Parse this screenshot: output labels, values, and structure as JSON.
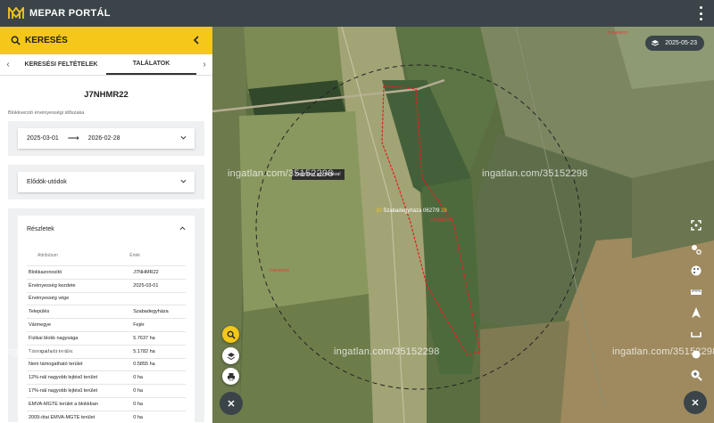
{
  "app": {
    "title": "MEPAR PORTÁL"
  },
  "panel": {
    "title": "KERESÉS",
    "tabs": [
      "KERESÉSI FELTÉTELEK",
      "TALÁLATOK"
    ],
    "block_id": "J7NHMR22",
    "period_label": "Blokkverzió érvényességi időszaka",
    "period_from": "2025-03-01",
    "period_arrow": "⟶",
    "period_to": "2026-02-28",
    "ancestors_label": "Elődök-utódok",
    "details_label": "Részletek",
    "table_headers": [
      "Attribútum",
      "Érték"
    ],
    "rows": [
      {
        "attr": "Blokkazonosító",
        "value": "J7NHMR22"
      },
      {
        "attr": "Érvényesség kezdete",
        "value": "2025-03-01"
      },
      {
        "attr": "Érvényesség vége",
        "value": ""
      },
      {
        "attr": "Település",
        "value": "Szabadegyháza"
      },
      {
        "attr": "Vármegye",
        "value": "Fejér"
      },
      {
        "attr": "Fizikai blokk nagysága",
        "value": "5.7637 ha"
      },
      {
        "attr": "Támogatható terület",
        "value": "5.1782 ha"
      },
      {
        "attr": "Nem támogatható terület",
        "value": "0.5855 ha"
      },
      {
        "attr": "12%-nál nagyobb lejtésű terület",
        "value": "0 ha"
      },
      {
        "attr": "17%-nál nagyobb lejtésű terület",
        "value": "0 ha"
      },
      {
        "attr": "EMVA-MGTE terület a blokkban",
        "value": "0 ha"
      },
      {
        "attr": "2009-ótai EMVA-MGTE terület",
        "value": "0 ha"
      }
    ]
  },
  "map": {
    "date": "2025-05-23",
    "tooltip": "Kattintson egy blokkra!",
    "parcel_prefix": "20",
    "parcel_name": "Szabadegyháza 0627/9",
    "parcel_suffix": "28",
    "parcel_sub": "J7NHMR22",
    "red_labels": [
      "J7NHMR22",
      "J7NHMR22"
    ],
    "watermark": "ingatlan.com/35152298"
  },
  "colors": {
    "accent": "#f4c719",
    "topbar": "#3a4449",
    "parcel": "#e02020"
  }
}
